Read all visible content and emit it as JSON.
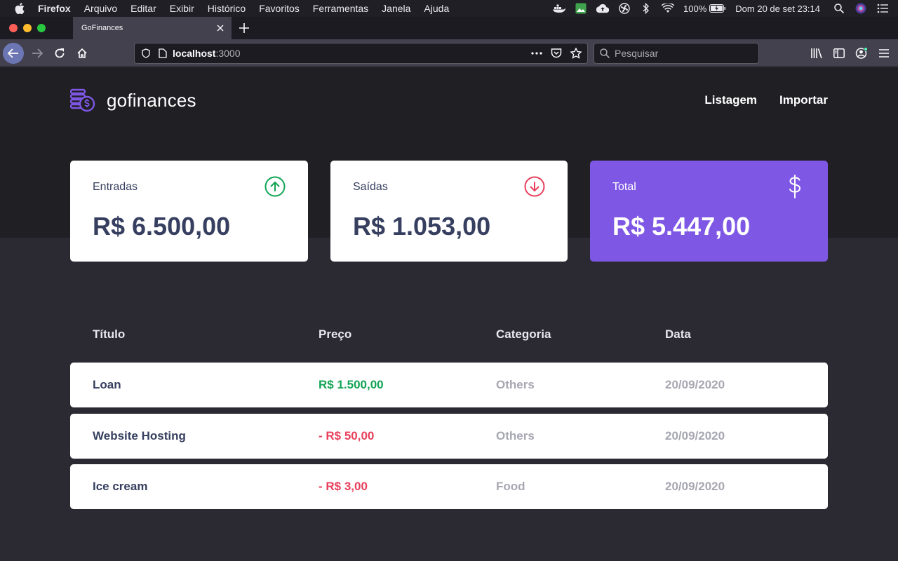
{
  "menubar": {
    "app": "Firefox",
    "items": [
      "Arquivo",
      "Editar",
      "Exibir",
      "Histórico",
      "Favoritos",
      "Ferramentas",
      "Janela",
      "Ajuda"
    ],
    "battery": "100%",
    "clock": "Dom 20 de set  23:14"
  },
  "browser": {
    "tab_title": "GoFinances",
    "url_host": "localhost",
    "url_port": ":3000",
    "search_placeholder": "Pesquisar"
  },
  "app": {
    "logo_text": "gofinances",
    "nav": [
      "Listagem",
      "Importar"
    ],
    "cards": [
      {
        "label": "Entradas",
        "value": "R$ 6.500,00",
        "icon": "arrow-up-circle-icon",
        "color": "#12a454"
      },
      {
        "label": "Saídas",
        "value": "R$ 1.053,00",
        "icon": "arrow-down-circle-icon",
        "color": "#e83f5b"
      },
      {
        "label": "Total",
        "value": "R$ 5.447,00",
        "icon": "dollar-sign-icon",
        "color": "#7f57e5"
      }
    ],
    "table": {
      "headers": [
        "Título",
        "Preço",
        "Categoria",
        "Data"
      ],
      "rows": [
        {
          "title": "Loan",
          "price": "R$ 1.500,00",
          "type": "income",
          "category": "Others",
          "date": "20/09/2020"
        },
        {
          "title": "Website Hosting",
          "price": "- R$ 50,00",
          "type": "outcome",
          "category": "Others",
          "date": "20/09/2020"
        },
        {
          "title": "Ice cream",
          "price": "- R$ 3,00",
          "type": "outcome",
          "category": "Food",
          "date": "20/09/2020"
        }
      ]
    }
  },
  "colors": {
    "income": "#12a454",
    "outcome": "#e83f5b",
    "primary": "#7f57e5",
    "text": "#363f5f",
    "muted": "#a7a7b2"
  }
}
